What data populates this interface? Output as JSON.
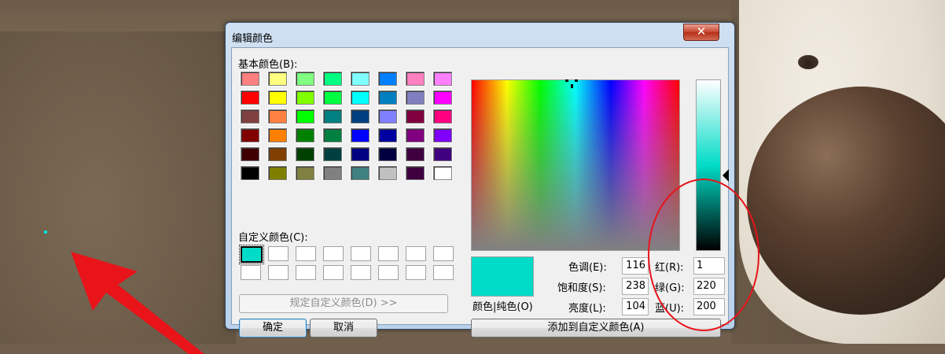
{
  "dialog": {
    "title": "编辑颜色",
    "close_symbol": "✕"
  },
  "basic_colors": {
    "label": "基本颜色(B):",
    "rows": [
      [
        "#ff8080",
        "#ffff80",
        "#80ff80",
        "#00ff80",
        "#80ffff",
        "#0080ff",
        "#ff80c0",
        "#ff80ff"
      ],
      [
        "#ff0000",
        "#ffff00",
        "#80ff00",
        "#00ff40",
        "#00ffff",
        "#0080c0",
        "#8080c0",
        "#ff00ff"
      ],
      [
        "#804040",
        "#ff8040",
        "#00ff00",
        "#008080",
        "#004080",
        "#8080ff",
        "#800040",
        "#ff0080"
      ],
      [
        "#800000",
        "#ff8000",
        "#008000",
        "#008040",
        "#0000ff",
        "#0000a0",
        "#800080",
        "#8000ff"
      ],
      [
        "#400000",
        "#804000",
        "#004000",
        "#004040",
        "#000080",
        "#000040",
        "#400040",
        "#400080"
      ],
      [
        "#000000",
        "#808000",
        "#808040",
        "#808080",
        "#408080",
        "#c0c0c0",
        "#400040",
        "#ffffff"
      ]
    ]
  },
  "custom_colors": {
    "label": "自定义颜色(C):",
    "selected_color": "#01dcc8"
  },
  "buttons": {
    "define_custom": "规定自定义颜色(D) >>",
    "ok": "确定",
    "cancel": "取消",
    "add_to_custom": "添加到自定义颜色(A)"
  },
  "preview": {
    "label": "颜色|纯色(O)",
    "color": "#01dcc8"
  },
  "hsl": {
    "hue_label": "色调(E):",
    "hue": "116",
    "sat_label": "饱和度(S):",
    "sat": "238",
    "lum_label": "亮度(L):",
    "lum": "104"
  },
  "rgb": {
    "red_label": "红(R):",
    "red": "1",
    "green_label": "绿(G):",
    "green": "220",
    "blue_label": "蓝(U):",
    "blue": "200"
  },
  "annotation_color": "#e8141a"
}
